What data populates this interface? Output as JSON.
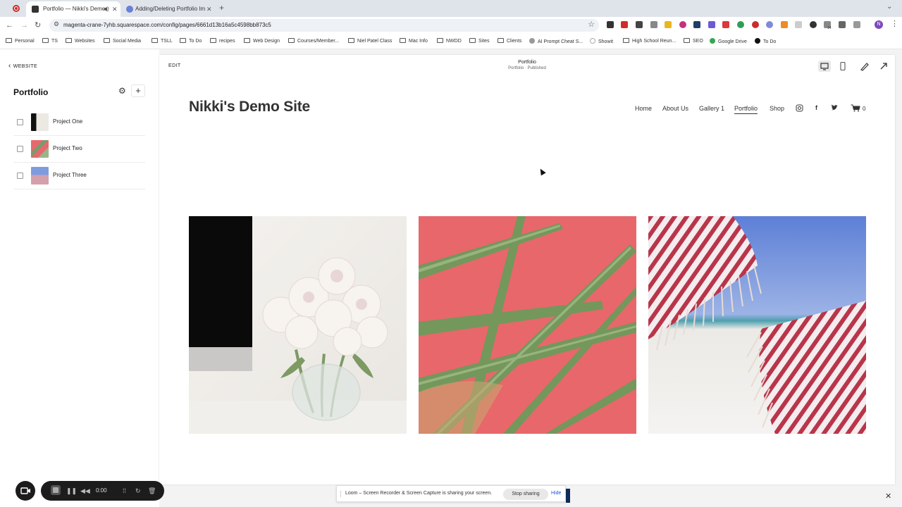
{
  "browser": {
    "tabs": [
      {
        "title": "Portfolio — Nikki's Demo",
        "active": true
      },
      {
        "title": "Adding/Deleting Portfolio Im",
        "active": false
      }
    ],
    "new_tab": "+",
    "url": "magenta-crane-7yhb.squarespace.com/config/pages/6661d13b16a5c4598bb873c5",
    "profile_initial": "N",
    "ext_badge": "14",
    "bookmarks": [
      "Personal",
      "TS",
      "Websites",
      "Social Media",
      "TSLL",
      "To Do",
      "recipes",
      "Web Design",
      "Courses/Member...",
      "Niel Patel Class",
      "Mac Info",
      "NWDD",
      "Sites",
      "Clients",
      "AI Prompt Cheat S...",
      "Showit",
      "High School Reun...",
      "SEO",
      "Google Drive",
      "To Do"
    ]
  },
  "sidebar": {
    "back_label": "WEBSITE",
    "title": "Portfolio",
    "projects": [
      {
        "label": "Project One"
      },
      {
        "label": "Project Two"
      },
      {
        "label": "Project Three"
      }
    ]
  },
  "editor": {
    "edit_label": "EDIT",
    "page_name": "Portfolio",
    "page_status": "Portfolio · Published"
  },
  "site": {
    "title": "Nikki's Demo Site",
    "nav": [
      "Home",
      "About Us",
      "Gallery 1",
      "Portfolio",
      "Shop"
    ],
    "current_nav": "Portfolio",
    "cart_count": "0"
  },
  "recorder": {
    "timer": "0:00"
  },
  "share_bar": {
    "message": "Loom – Screen Recorder & Screen Capture is sharing your screen.",
    "stop_label": "Stop sharing",
    "hide_label": "Hide"
  }
}
